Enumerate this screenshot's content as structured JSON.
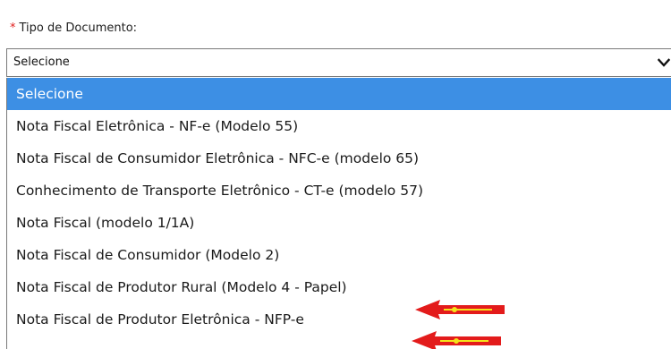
{
  "field": {
    "required_mark": "*",
    "label": "Tipo de Documento:"
  },
  "select": {
    "value": "Selecione"
  },
  "options": [
    {
      "label": "Selecione",
      "selected": true
    },
    {
      "label": "Nota Fiscal Eletrônica - NF-e (Modelo 55)"
    },
    {
      "label": "Nota Fiscal de Consumidor Eletrônica - NFC-e (modelo 65)"
    },
    {
      "label": "Conhecimento de Transporte Eletrônico - CT-e (modelo 57)"
    },
    {
      "label": "Nota Fiscal (modelo 1/1A)"
    },
    {
      "label": "Nota Fiscal de Consumidor (Modelo 2)"
    },
    {
      "label": "Nota Fiscal de Produtor Rural (Modelo 4 - Papel)"
    },
    {
      "label": "Nota Fiscal de Produtor Eletrônica - NFP-e"
    }
  ],
  "colors": {
    "highlight": "#3d8fe4",
    "required": "#e0201e",
    "annotation_arrow": "#e31b1b",
    "annotation_arrow_core": "#f4e21a"
  },
  "icons": {
    "dropdown": "chevron-down-icon",
    "annotation": "red-arrow-icon"
  }
}
